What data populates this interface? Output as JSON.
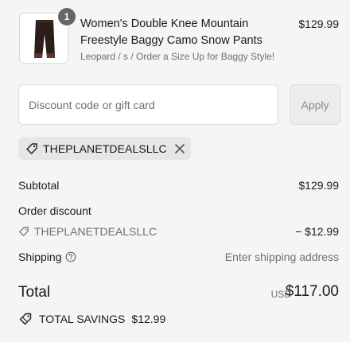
{
  "product": {
    "quantity": "1",
    "title_line1": "Women's Double Knee Mountain",
    "title_line2": "Freestyle Baggy Camo Snow Pants",
    "variant": "Leopard / s / Order a Size Up for Baggy Style!",
    "price": "$129.99",
    "thumbnail_icon": "snow-pants-image"
  },
  "discount": {
    "placeholder": "Discount code or gift card",
    "apply_label": "Apply",
    "applied_code": "THEPLANETDEALSLLC"
  },
  "summary": {
    "subtotal_label": "Subtotal",
    "subtotal_value": "$129.99",
    "order_discount_label": "Order discount",
    "order_discount_code": "THEPLANETDEALSLLC",
    "order_discount_value": "− $12.99",
    "shipping_label": "Shipping",
    "shipping_value": "Enter shipping address",
    "total_label": "Total",
    "total_currency": "USD",
    "total_value": "$117.00",
    "savings_label": "TOTAL SAVINGS",
    "savings_value": "$12.99"
  },
  "colors": {
    "background": "#f5f5f5",
    "text": "#1a1a1a",
    "muted": "#707070",
    "badge": "#666666"
  }
}
